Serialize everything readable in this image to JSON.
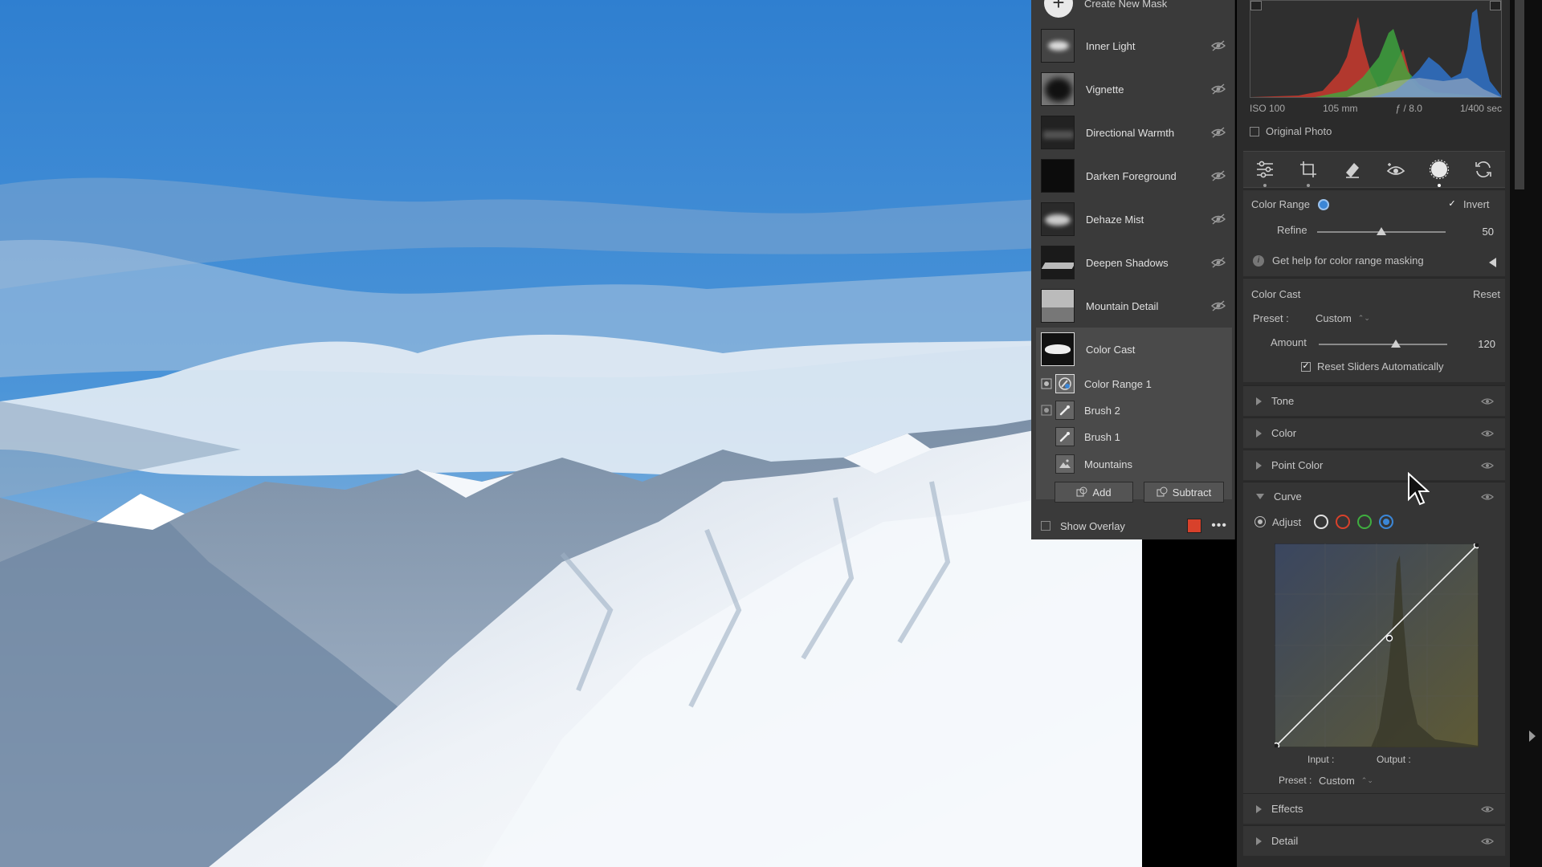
{
  "masks": {
    "create_label": "Create New Mask",
    "items": [
      {
        "label": "Inner Light"
      },
      {
        "label": "Vignette"
      },
      {
        "label": "Directional Warmth"
      },
      {
        "label": "Darken Foreground"
      },
      {
        "label": "Dehaze Mist"
      },
      {
        "label": "Deepen Shadows"
      },
      {
        "label": "Mountain Detail"
      }
    ],
    "selected": {
      "label": "Color Cast",
      "components": [
        {
          "label": "Color Range 1"
        },
        {
          "label": "Brush 2"
        },
        {
          "label": "Brush 1"
        },
        {
          "label": "Mountains"
        }
      ]
    },
    "add_label": "Add",
    "subtract_label": "Subtract",
    "show_overlay_label": "Show Overlay",
    "overlay_color": "#d8412b"
  },
  "exif": {
    "iso": "ISO 100",
    "focal": "105 mm",
    "aperture": "ƒ / 8.0",
    "shutter": "1/400 sec"
  },
  "original_photo_label": "Original Photo",
  "color_range": {
    "label": "Color Range",
    "invert_label": "Invert",
    "invert_checked": true,
    "refine_label": "Refine",
    "refine_value": "50",
    "refine_fraction": 0.5,
    "help_label": "Get help for color range masking"
  },
  "color_cast": {
    "title": "Color Cast",
    "reset_label": "Reset",
    "preset_label": "Preset :",
    "preset_value": "Custom",
    "amount_label": "Amount",
    "amount_value": "120",
    "amount_fraction": 0.6,
    "reset_sliders_label": "Reset Sliders Automatically"
  },
  "sections": {
    "tone": "Tone",
    "color": "Color",
    "point_color": "Point Color",
    "curve": "Curve",
    "effects": "Effects",
    "detail": "Detail"
  },
  "curve": {
    "adjust_label": "Adjust",
    "input_label": "Input :",
    "output_label": "Output :",
    "preset_label": "Preset :",
    "preset_value": "Custom"
  },
  "colors": {
    "accent_blue": "#3b86d6",
    "channel_red": "#d8412b",
    "channel_green": "#3fae3f"
  }
}
